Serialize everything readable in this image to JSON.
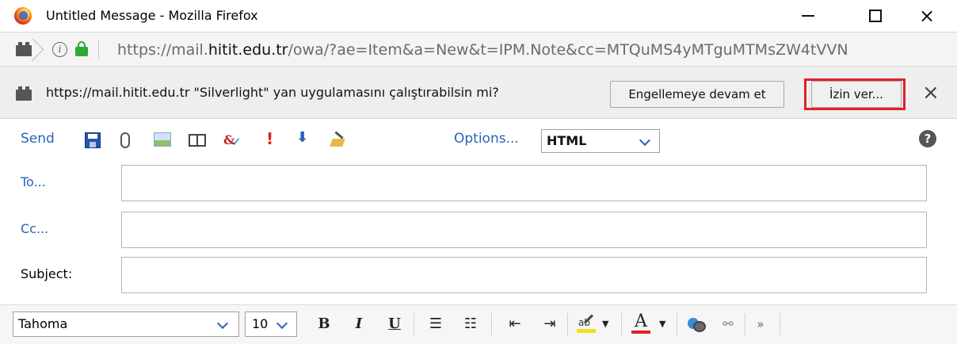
{
  "window": {
    "title": "Untitled Message - Mozilla Firefox",
    "close_symbol": "×"
  },
  "urlbar": {
    "info_symbol": "i",
    "url_prefix": "https://mail.",
    "url_domain": "hitit.edu.tr",
    "url_suffix": "/owa/?ae=Item&a=New&t=IPM.Note&cc=MTQuMS4yMTguMTMsZW4tVVN"
  },
  "notification": {
    "message": "https://mail.hitit.edu.tr \"Silverlight\" yan uygulamasını çalıştırabilsin mi?",
    "block_button": "Engellemeye devam et",
    "allow_button": "İzin ver...",
    "close_symbol": "×",
    "highlight_color": "#e0202a"
  },
  "toolbar": {
    "send_label": "Send",
    "options_label": "Options...",
    "format_value": "HTML",
    "importance_high_glyph": "!",
    "importance_low_glyph": "⬇",
    "spell_glyph": "&",
    "help_glyph": "?",
    "link_color": "#2a63b5"
  },
  "fields": {
    "to_label": "To...",
    "cc_label": "Cc...",
    "subject_label": "Subject:",
    "to_value": "",
    "cc_value": "",
    "subject_value": ""
  },
  "formatting": {
    "font_value": "Tahoma",
    "size_value": "10",
    "bold_glyph": "B",
    "italic_glyph": "I",
    "underline_glyph": "U",
    "bullets_glyph": "☰",
    "numbers_glyph": "☷",
    "outdent_glyph": "⇤",
    "indent_glyph": "⇥",
    "highlight_glyph": "ab",
    "font_color_glyph": "A",
    "dropdown_glyph": "▼",
    "unlink_glyph": "⚯",
    "more_glyph": "»"
  }
}
